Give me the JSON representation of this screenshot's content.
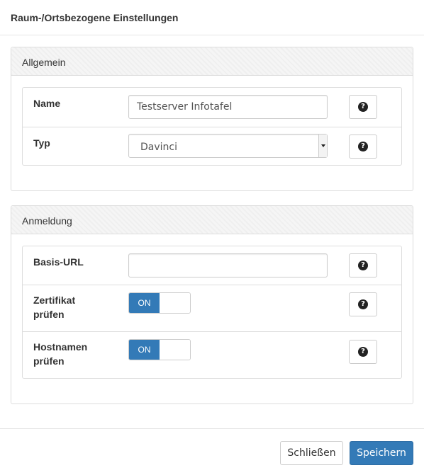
{
  "dialog": {
    "title": "Raum-/Ortsbezogene Einstellungen"
  },
  "panels": {
    "allgemein": {
      "heading": "Allgemein",
      "name_label": "Name",
      "name_value": "Testserver Infotafel",
      "typ_label": "Typ",
      "typ_value": "Davinci"
    },
    "anmeldung": {
      "heading": "Anmeldung",
      "basis_url_label": "Basis-URL",
      "basis_url_value": "",
      "zertifikat_label_line1": "Zertifikat",
      "zertifikat_label_line2": "prüfen",
      "zertifikat_state": "ON",
      "hostnamen_label_line1": "Hostnamen",
      "hostnamen_label_line2": "prüfen",
      "hostnamen_state": "ON"
    }
  },
  "help": {
    "icon": "question-circle-icon",
    "glyph": "?"
  },
  "footer": {
    "close_label": "Schließen",
    "save_label": "Speichern"
  },
  "colors": {
    "primary": "#337ab7",
    "border": "#dddddd",
    "panel_heading_bg": "#f5f5f5"
  }
}
